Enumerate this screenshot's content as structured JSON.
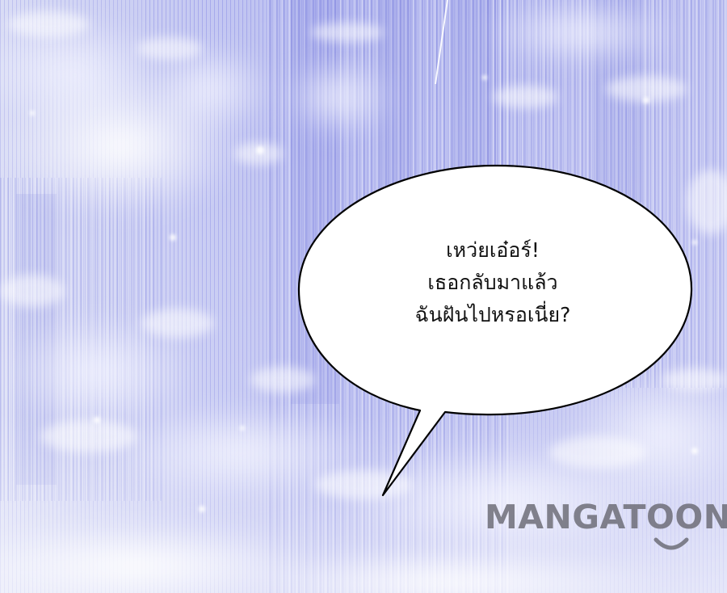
{
  "panel": {
    "bubble": {
      "lines": [
        "เหว่ยเอ๋อร์!",
        "เธอกลับมาแล้ว",
        "ฉันฝันไปหรอเนี่ย?"
      ]
    },
    "watermark": {
      "text": "MANGATOON"
    }
  },
  "colors": {
    "background_light": "#e4e7f8",
    "background_blue": "#8f93e6",
    "bubble_fill": "#ffffff",
    "bubble_outline": "#000000",
    "watermark": "#69696f"
  },
  "icons": {
    "watermark_smile": "smile-icon"
  }
}
